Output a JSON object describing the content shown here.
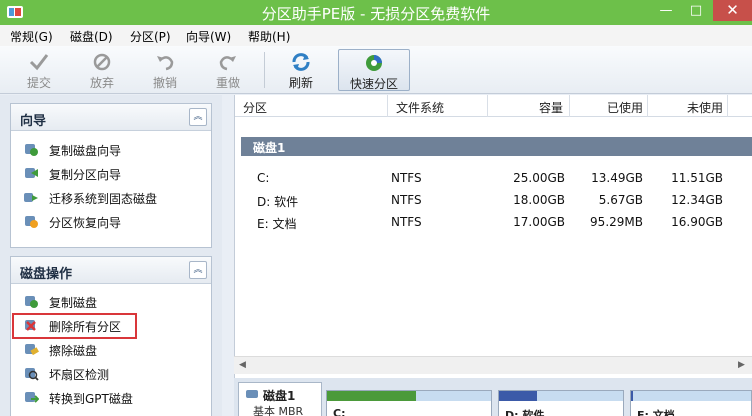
{
  "window": {
    "title": "分区助手PE版 - 无损分区免费软件",
    "min_icon": "minimize-icon",
    "max_icon": "maximize-icon",
    "close_icon": "close-icon",
    "accent_color": "#6dc04a"
  },
  "menu": {
    "items": [
      "常规(G)",
      "磁盘(D)",
      "分区(P)",
      "向导(W)",
      "帮助(H)"
    ]
  },
  "toolbar": {
    "commit": "提交",
    "discard": "放弃",
    "undo": "撤销",
    "redo": "重做",
    "refresh": "刷新",
    "quick_partition": "快速分区"
  },
  "wizard_panel": {
    "title": "向导",
    "items": [
      "复制磁盘向导",
      "复制分区向导",
      "迁移系统到固态磁盘",
      "分区恢复向导"
    ]
  },
  "disk_ops_panel": {
    "title": "磁盘操作",
    "items": [
      "复制磁盘",
      "删除所有分区",
      "擦除磁盘",
      "坏扇区检测",
      "转换到GPT磁盘"
    ]
  },
  "table": {
    "headers": {
      "partition": "分区",
      "filesystem": "文件系统",
      "capacity": "容量",
      "used": "已使用",
      "unused": "未使用"
    },
    "disk_label": "磁盘1",
    "rows": [
      {
        "partition": "C:",
        "fs": "NTFS",
        "capacity": "25.00GB",
        "used": "13.49GB",
        "unused": "11.51GB"
      },
      {
        "partition": "D: 软件",
        "fs": "NTFS",
        "capacity": "18.00GB",
        "used": "5.67GB",
        "unused": "12.34GB"
      },
      {
        "partition": "E: 文档",
        "fs": "NTFS",
        "capacity": "17.00GB",
        "used": "95.29MB",
        "unused": "16.90GB"
      }
    ]
  },
  "disk_map": {
    "disk_name": "磁盘1",
    "disk_type": "基本 MBR",
    "partitions": [
      {
        "label": "C:",
        "used_fraction": 0.54
      },
      {
        "label": "D: 软件",
        "used_fraction": 0.31
      },
      {
        "label": "E: 文档",
        "used_fraction": 0.01
      }
    ]
  }
}
